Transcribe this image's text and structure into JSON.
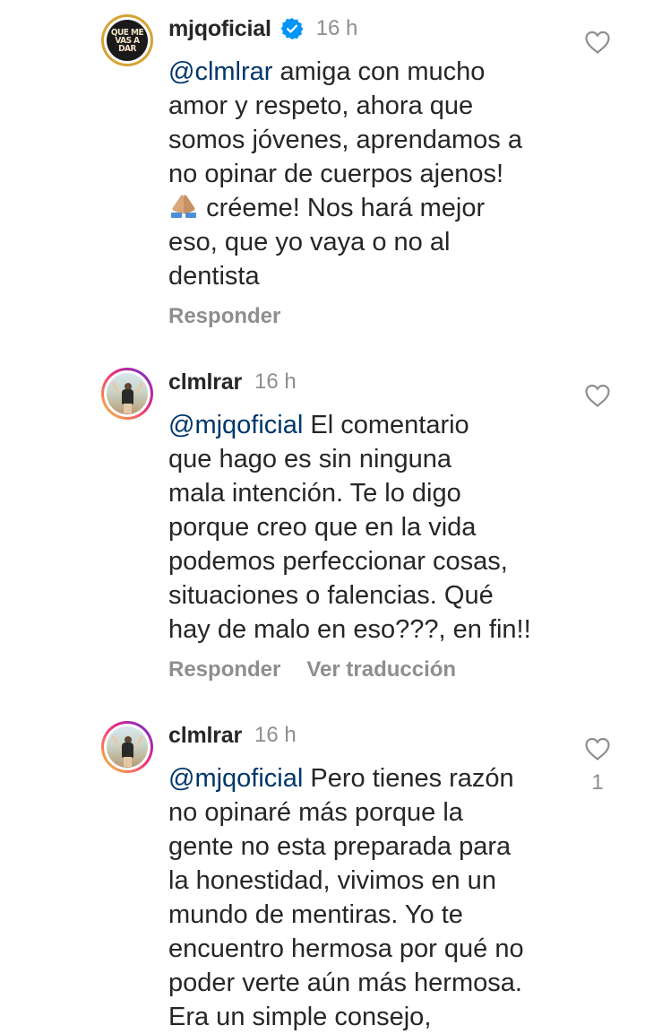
{
  "comments": [
    {
      "username": "mjqoficial",
      "verified": true,
      "time": "16 h",
      "avatar_text": "QUE ME VAS A DAR",
      "mention": "@clmlrar",
      "text_lines": [
        "amiga con mucho",
        "amor y respeto, ahora que",
        "somos jóvenes, aprendamos a",
        "no opinar de cuerpos ajenos!",
        "créeme! Nos hará mejor",
        "eso, que yo vaya o no al",
        "dentista"
      ],
      "emoji": "folded-hands",
      "actions": [
        "Responder"
      ],
      "like_count": ""
    },
    {
      "username": "clmlrar",
      "verified": false,
      "time": "16 h",
      "mention": "@mjqoficial",
      "text_lines": [
        "El comentario",
        "que hago es sin ninguna",
        "mala intención. Te lo digo",
        "porque creo que en la vida",
        "podemos perfeccionar cosas,",
        "situaciones o falencias. Qué",
        "hay de malo en eso???, en fin!!"
      ],
      "actions": [
        "Responder",
        "Ver traducción"
      ],
      "like_count": ""
    },
    {
      "username": "clmlrar",
      "verified": false,
      "time": "16 h",
      "mention": "@mjqoficial",
      "text_lines": [
        "Pero tienes razón",
        "no opinaré más porque la",
        "gente no esta preparada para",
        "la honestidad, vivimos en un",
        "mundo de mentiras. Yo te",
        "encuentro hermosa por qué no",
        "poder verte aún más hermosa.",
        "Era un simple consejo,"
      ],
      "actions": [],
      "like_count": "1"
    }
  ],
  "icons": {
    "like": "heart-outline-icon",
    "verified": "verified-badge-icon",
    "emoji": "folded-hands-emoji"
  },
  "colors": {
    "text": "#262626",
    "muted": "#8e8e8e",
    "mention": "#00376b",
    "verified": "#0095f6"
  }
}
